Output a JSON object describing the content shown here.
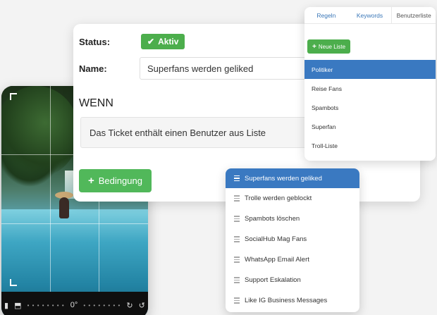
{
  "main": {
    "status_label": "Status:",
    "status_value": "Aktiv",
    "name_label": "Name:",
    "name_value": "Superfans werden geliked",
    "section_title": "WENN",
    "condition_text": "Das Ticket enthält einen Benutzer aus Liste",
    "add_condition_label": "Bedingung"
  },
  "lists_panel": {
    "tabs": [
      "Regeln",
      "Keywords",
      "Benutzerliste"
    ],
    "active_tab": "Benutzerliste",
    "new_list_label": "Neue Liste",
    "items": [
      "Politiker",
      "Reise Fans",
      "Spambots",
      "Superfan",
      "Troll-Liste"
    ],
    "selected": "Politiker"
  },
  "rules_panel": {
    "items": [
      "Superfans werden geliked",
      "Trolle werden geblockt",
      "Spambots löschen",
      "SocialHub Mag Fans",
      "WhatsApp Email Alert",
      "Support Eskalation",
      "Like IG Business Messages"
    ],
    "selected": "Superfans werden geliked"
  },
  "phone": {
    "angle_readout": "0°"
  },
  "colors": {
    "green": "#4cae4c",
    "blue": "#3a79c1",
    "link_blue": "#3a77b8"
  }
}
